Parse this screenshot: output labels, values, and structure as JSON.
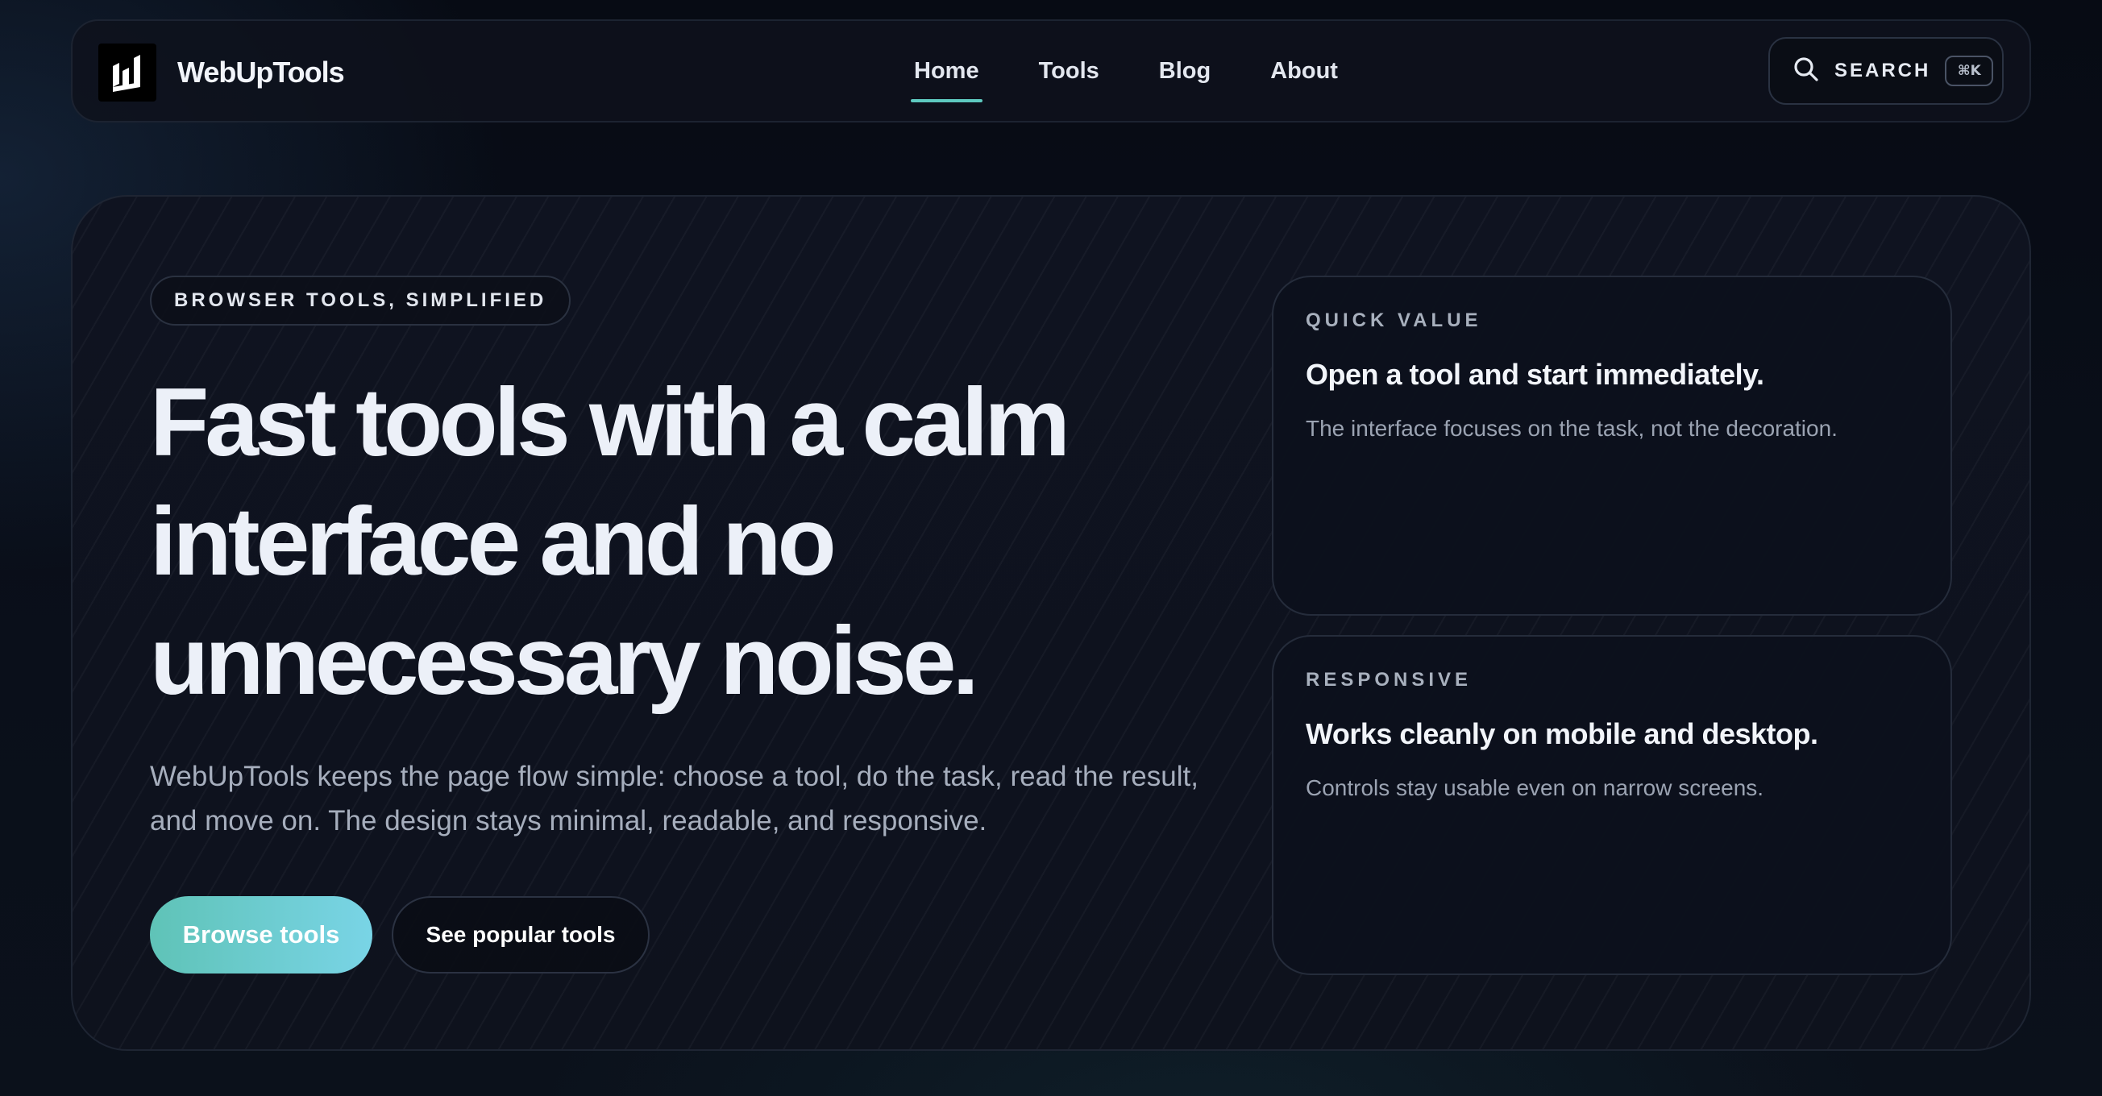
{
  "header": {
    "brand": "WebUpTools",
    "logo_icon": "webuptools-logo",
    "nav": [
      {
        "label": "Home",
        "active": true
      },
      {
        "label": "Tools",
        "active": false
      },
      {
        "label": "Blog",
        "active": false
      },
      {
        "label": "About",
        "active": false
      }
    ],
    "search": {
      "icon": "search-icon",
      "label": "SEARCH",
      "shortcut": "⌘K"
    }
  },
  "hero": {
    "eyebrow": "BROWSER TOOLS, SIMPLIFIED",
    "title": "Fast tools with a calm interface and no unnecessary noise.",
    "description": "WebUpTools keeps the page flow simple: choose a tool, do the task, read the result, and move on. The design stays minimal, readable, and responsive.",
    "primary_cta": "Browse tools",
    "secondary_cta": "See popular tools"
  },
  "cards": [
    {
      "eyebrow": "QUICK VALUE",
      "title": "Open a tool and start immediately.",
      "text": "The interface focuses on the task, not the decoration."
    },
    {
      "eyebrow": "RESPONSIVE",
      "title": "Works cleanly on mobile and desktop.",
      "text": "Controls stay usable even on narrow screens."
    }
  ],
  "colors": {
    "accent": "#5ec9c0",
    "cta_gradient_start": "#5fc3b7",
    "cta_gradient_end": "#79d4e6",
    "background": "#0a0f1a"
  }
}
